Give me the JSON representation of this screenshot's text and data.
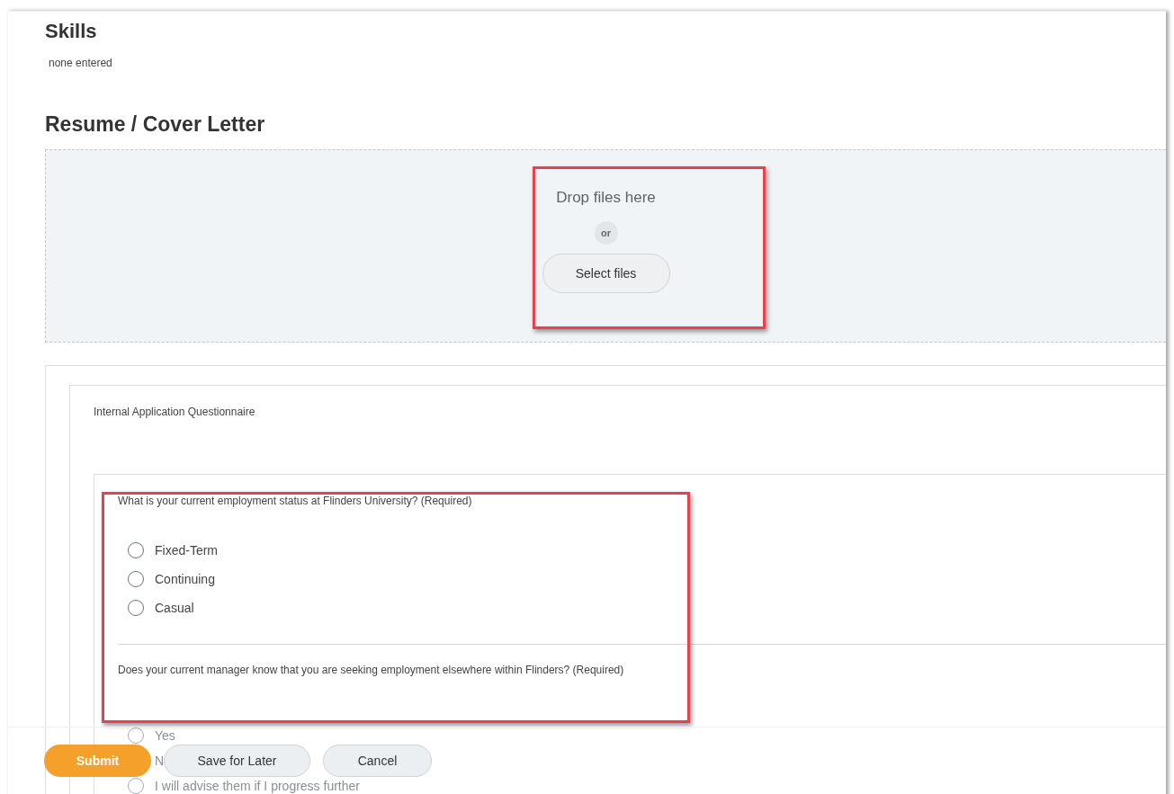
{
  "skills": {
    "heading": "Skills",
    "value": "none entered"
  },
  "resume": {
    "heading": "Resume / Cover Letter",
    "drop_text": "Drop files here",
    "separator": "or",
    "button": "Select files"
  },
  "questionnaire": {
    "title": "Internal Application Questionnaire",
    "questions": [
      {
        "text": "What is your current employment status at Flinders University? (Required)",
        "options": [
          {
            "label": "Fixed-Term",
            "selected": false
          },
          {
            "label": "Continuing",
            "selected": false
          },
          {
            "label": "Casual",
            "selected": false
          }
        ]
      },
      {
        "text": "Does your current manager know that you are seeking employment elsewhere within Flinders? (Required)",
        "options": [
          {
            "label": "Yes",
            "selected": false
          },
          {
            "label": "N"
          },
          {
            "label": "I will advise them if I progress further",
            "selected": false
          }
        ]
      }
    ]
  },
  "annotations": [
    {
      "kind": "highlight"
    },
    {
      "kind": "highlight"
    }
  ],
  "footer": {
    "buttons": [
      {
        "label": "Submit",
        "kind": "primary"
      },
      {
        "label": "Save for Later",
        "kind": "secondary"
      },
      {
        "label": "Cancel",
        "kind": "secondary"
      }
    ]
  }
}
